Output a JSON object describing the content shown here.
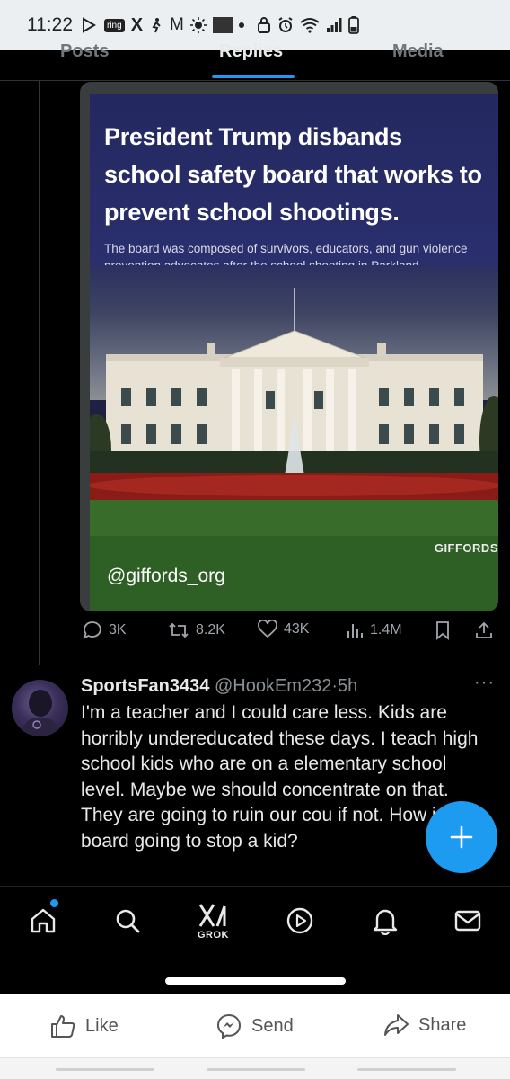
{
  "status_bar": {
    "time": "11:22",
    "ring_label": "ring",
    "x_label": "X",
    "m_label": "M"
  },
  "tabs": [
    {
      "label": "Posts"
    },
    {
      "label": "Replies",
      "active": true
    },
    {
      "label": "Media"
    }
  ],
  "quoted_post": {
    "headline": "President Trump disbands school safety board that works to prevent school shootings.",
    "subhead": "The board was composed of survivors, educators, and gun violence prevention advocates after the school shooting in Parkland.",
    "watermark": "GIFFORDS",
    "handle": "@giffords_org"
  },
  "actions": {
    "replies": "3K",
    "reposts": "8.2K",
    "likes": "43K",
    "views": "1.4M"
  },
  "reply": {
    "display_name": "SportsFan3434",
    "handle": "@HookEm232",
    "separator": "·",
    "time": "5h",
    "more": "···",
    "text": "I'm a teacher and I could care less. Kids are horribly undereducated these days. I teach high school kids who are on a elementary school level. Maybe we should concentrate on that. They are going to ruin our cou if not. How is a board going to stop a kid?"
  },
  "fab": {
    "icon": "plus-icon",
    "label": "+"
  },
  "bottom_nav": {
    "items": [
      "home-icon",
      "search-icon",
      "grok-icon",
      "video-icon",
      "notifications-icon",
      "messages-icon"
    ],
    "grok_label": "GROK",
    "accent": "#1d9bf0"
  },
  "share_bar": {
    "like": "Like",
    "send": "Send",
    "share": "Share"
  },
  "colors": {
    "accent": "#1d9bf0",
    "background": "#000000",
    "muted_text": "#8b9095"
  }
}
